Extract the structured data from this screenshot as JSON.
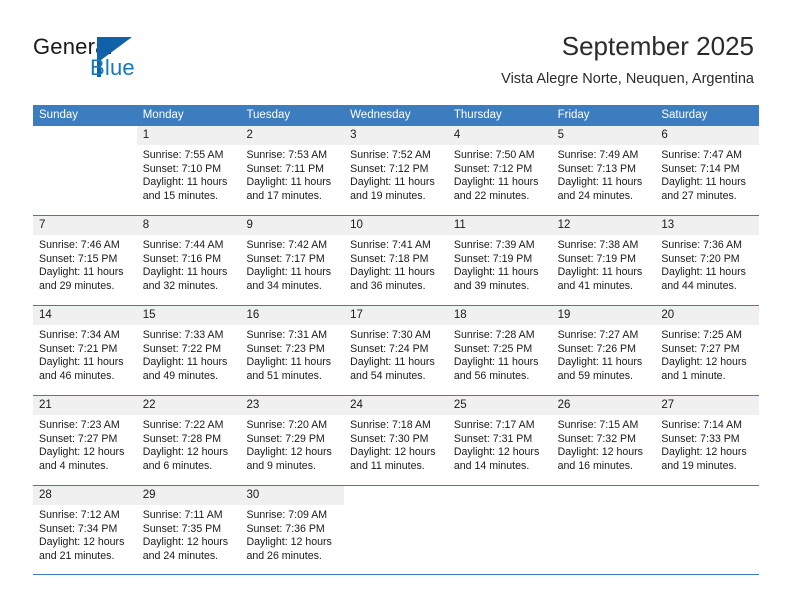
{
  "brand": {
    "name_part1": "General",
    "name_part2": "Blue",
    "logo_icon": "triangle-flag-icon",
    "accent_color": "#1061a8",
    "text_color": "#1878be"
  },
  "header": {
    "title": "September 2025",
    "subtitle": "Vista Alegre Norte, Neuquen, Argentina"
  },
  "theme": {
    "header_row_bg": "#3b7dbf",
    "day_number_bg": "#f0f0f0",
    "grid_line": "#3b7dbf",
    "text": "#1a1a1a"
  },
  "weekdays": [
    "Sunday",
    "Monday",
    "Tuesday",
    "Wednesday",
    "Thursday",
    "Friday",
    "Saturday"
  ],
  "weeks": [
    [
      {
        "day": "",
        "sunrise": "",
        "sunset": "",
        "daylight_line1": "",
        "daylight_line2": ""
      },
      {
        "day": "1",
        "sunrise": "Sunrise: 7:55 AM",
        "sunset": "Sunset: 7:10 PM",
        "daylight_line1": "Daylight: 11 hours",
        "daylight_line2": "and 15 minutes."
      },
      {
        "day": "2",
        "sunrise": "Sunrise: 7:53 AM",
        "sunset": "Sunset: 7:11 PM",
        "daylight_line1": "Daylight: 11 hours",
        "daylight_line2": "and 17 minutes."
      },
      {
        "day": "3",
        "sunrise": "Sunrise: 7:52 AM",
        "sunset": "Sunset: 7:12 PM",
        "daylight_line1": "Daylight: 11 hours",
        "daylight_line2": "and 19 minutes."
      },
      {
        "day": "4",
        "sunrise": "Sunrise: 7:50 AM",
        "sunset": "Sunset: 7:12 PM",
        "daylight_line1": "Daylight: 11 hours",
        "daylight_line2": "and 22 minutes."
      },
      {
        "day": "5",
        "sunrise": "Sunrise: 7:49 AM",
        "sunset": "Sunset: 7:13 PM",
        "daylight_line1": "Daylight: 11 hours",
        "daylight_line2": "and 24 minutes."
      },
      {
        "day": "6",
        "sunrise": "Sunrise: 7:47 AM",
        "sunset": "Sunset: 7:14 PM",
        "daylight_line1": "Daylight: 11 hours",
        "daylight_line2": "and 27 minutes."
      }
    ],
    [
      {
        "day": "7",
        "sunrise": "Sunrise: 7:46 AM",
        "sunset": "Sunset: 7:15 PM",
        "daylight_line1": "Daylight: 11 hours",
        "daylight_line2": "and 29 minutes."
      },
      {
        "day": "8",
        "sunrise": "Sunrise: 7:44 AM",
        "sunset": "Sunset: 7:16 PM",
        "daylight_line1": "Daylight: 11 hours",
        "daylight_line2": "and 32 minutes."
      },
      {
        "day": "9",
        "sunrise": "Sunrise: 7:42 AM",
        "sunset": "Sunset: 7:17 PM",
        "daylight_line1": "Daylight: 11 hours",
        "daylight_line2": "and 34 minutes."
      },
      {
        "day": "10",
        "sunrise": "Sunrise: 7:41 AM",
        "sunset": "Sunset: 7:18 PM",
        "daylight_line1": "Daylight: 11 hours",
        "daylight_line2": "and 36 minutes."
      },
      {
        "day": "11",
        "sunrise": "Sunrise: 7:39 AM",
        "sunset": "Sunset: 7:19 PM",
        "daylight_line1": "Daylight: 11 hours",
        "daylight_line2": "and 39 minutes."
      },
      {
        "day": "12",
        "sunrise": "Sunrise: 7:38 AM",
        "sunset": "Sunset: 7:19 PM",
        "daylight_line1": "Daylight: 11 hours",
        "daylight_line2": "and 41 minutes."
      },
      {
        "day": "13",
        "sunrise": "Sunrise: 7:36 AM",
        "sunset": "Sunset: 7:20 PM",
        "daylight_line1": "Daylight: 11 hours",
        "daylight_line2": "and 44 minutes."
      }
    ],
    [
      {
        "day": "14",
        "sunrise": "Sunrise: 7:34 AM",
        "sunset": "Sunset: 7:21 PM",
        "daylight_line1": "Daylight: 11 hours",
        "daylight_line2": "and 46 minutes."
      },
      {
        "day": "15",
        "sunrise": "Sunrise: 7:33 AM",
        "sunset": "Sunset: 7:22 PM",
        "daylight_line1": "Daylight: 11 hours",
        "daylight_line2": "and 49 minutes."
      },
      {
        "day": "16",
        "sunrise": "Sunrise: 7:31 AM",
        "sunset": "Sunset: 7:23 PM",
        "daylight_line1": "Daylight: 11 hours",
        "daylight_line2": "and 51 minutes."
      },
      {
        "day": "17",
        "sunrise": "Sunrise: 7:30 AM",
        "sunset": "Sunset: 7:24 PM",
        "daylight_line1": "Daylight: 11 hours",
        "daylight_line2": "and 54 minutes."
      },
      {
        "day": "18",
        "sunrise": "Sunrise: 7:28 AM",
        "sunset": "Sunset: 7:25 PM",
        "daylight_line1": "Daylight: 11 hours",
        "daylight_line2": "and 56 minutes."
      },
      {
        "day": "19",
        "sunrise": "Sunrise: 7:27 AM",
        "sunset": "Sunset: 7:26 PM",
        "daylight_line1": "Daylight: 11 hours",
        "daylight_line2": "and 59 minutes."
      },
      {
        "day": "20",
        "sunrise": "Sunrise: 7:25 AM",
        "sunset": "Sunset: 7:27 PM",
        "daylight_line1": "Daylight: 12 hours",
        "daylight_line2": "and 1 minute."
      }
    ],
    [
      {
        "day": "21",
        "sunrise": "Sunrise: 7:23 AM",
        "sunset": "Sunset: 7:27 PM",
        "daylight_line1": "Daylight: 12 hours",
        "daylight_line2": "and 4 minutes."
      },
      {
        "day": "22",
        "sunrise": "Sunrise: 7:22 AM",
        "sunset": "Sunset: 7:28 PM",
        "daylight_line1": "Daylight: 12 hours",
        "daylight_line2": "and 6 minutes."
      },
      {
        "day": "23",
        "sunrise": "Sunrise: 7:20 AM",
        "sunset": "Sunset: 7:29 PM",
        "daylight_line1": "Daylight: 12 hours",
        "daylight_line2": "and 9 minutes."
      },
      {
        "day": "24",
        "sunrise": "Sunrise: 7:18 AM",
        "sunset": "Sunset: 7:30 PM",
        "daylight_line1": "Daylight: 12 hours",
        "daylight_line2": "and 11 minutes."
      },
      {
        "day": "25",
        "sunrise": "Sunrise: 7:17 AM",
        "sunset": "Sunset: 7:31 PM",
        "daylight_line1": "Daylight: 12 hours",
        "daylight_line2": "and 14 minutes."
      },
      {
        "day": "26",
        "sunrise": "Sunrise: 7:15 AM",
        "sunset": "Sunset: 7:32 PM",
        "daylight_line1": "Daylight: 12 hours",
        "daylight_line2": "and 16 minutes."
      },
      {
        "day": "27",
        "sunrise": "Sunrise: 7:14 AM",
        "sunset": "Sunset: 7:33 PM",
        "daylight_line1": "Daylight: 12 hours",
        "daylight_line2": "and 19 minutes."
      }
    ],
    [
      {
        "day": "28",
        "sunrise": "Sunrise: 7:12 AM",
        "sunset": "Sunset: 7:34 PM",
        "daylight_line1": "Daylight: 12 hours",
        "daylight_line2": "and 21 minutes."
      },
      {
        "day": "29",
        "sunrise": "Sunrise: 7:11 AM",
        "sunset": "Sunset: 7:35 PM",
        "daylight_line1": "Daylight: 12 hours",
        "daylight_line2": "and 24 minutes."
      },
      {
        "day": "30",
        "sunrise": "Sunrise: 7:09 AM",
        "sunset": "Sunset: 7:36 PM",
        "daylight_line1": "Daylight: 12 hours",
        "daylight_line2": "and 26 minutes."
      },
      {
        "day": "",
        "sunrise": "",
        "sunset": "",
        "daylight_line1": "",
        "daylight_line2": ""
      },
      {
        "day": "",
        "sunrise": "",
        "sunset": "",
        "daylight_line1": "",
        "daylight_line2": ""
      },
      {
        "day": "",
        "sunrise": "",
        "sunset": "",
        "daylight_line1": "",
        "daylight_line2": ""
      },
      {
        "day": "",
        "sunrise": "",
        "sunset": "",
        "daylight_line1": "",
        "daylight_line2": ""
      }
    ]
  ]
}
